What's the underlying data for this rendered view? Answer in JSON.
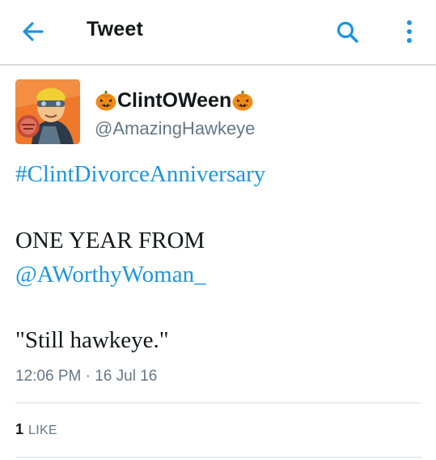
{
  "header": {
    "title": "Tweet",
    "back_icon": "arrow-left-icon",
    "search_icon": "search-icon",
    "more_icon": "more-vertical-icon"
  },
  "author": {
    "display_name": "ClintOWeen",
    "handle": "@AmazingHawkeye",
    "name_emoji": "jack-o-lantern-icon"
  },
  "tweet": {
    "hashtag": "#ClintDivorceAnniversary",
    "line_text": "ONE YEAR FROM",
    "mention": "@AWorthyWoman_",
    "quote": "\"Still hawkeye.\""
  },
  "meta": {
    "timestamp": "12:06 PM · 16 Jul 16"
  },
  "stats": {
    "like_count": "1",
    "like_label": "LIKE"
  },
  "colors": {
    "accent": "#1b95e0",
    "text": "#14171a",
    "secondary": "#657786",
    "divider": "#d9dde0",
    "pumpkin": "#f08a17"
  }
}
